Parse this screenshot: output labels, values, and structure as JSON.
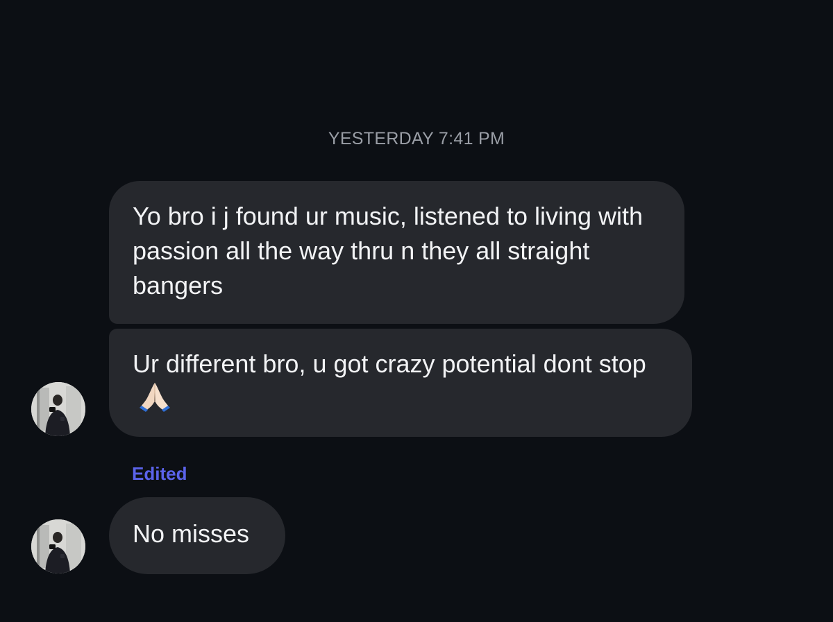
{
  "conversation": {
    "timestamp": "YESTERDAY 7:41 PM",
    "messages": [
      {
        "text": "Yo bro i j found ur music, listened to living with passion all the way thru n they all straight bangers"
      },
      {
        "text": "Ur different bro, u got crazy potential dont stop",
        "emoji": "folded-hands"
      },
      {
        "text": "No misses"
      }
    ],
    "edited_label": "Edited"
  },
  "colors": {
    "background": "#0c0f14",
    "bubble": "#26282d",
    "text": "#f2f3f5",
    "timestamp": "#9a9ea6",
    "edited": "#5b63ea"
  },
  "icons": {
    "avatar": "sender-avatar-photo",
    "emoji": "folded-hands-icon"
  }
}
